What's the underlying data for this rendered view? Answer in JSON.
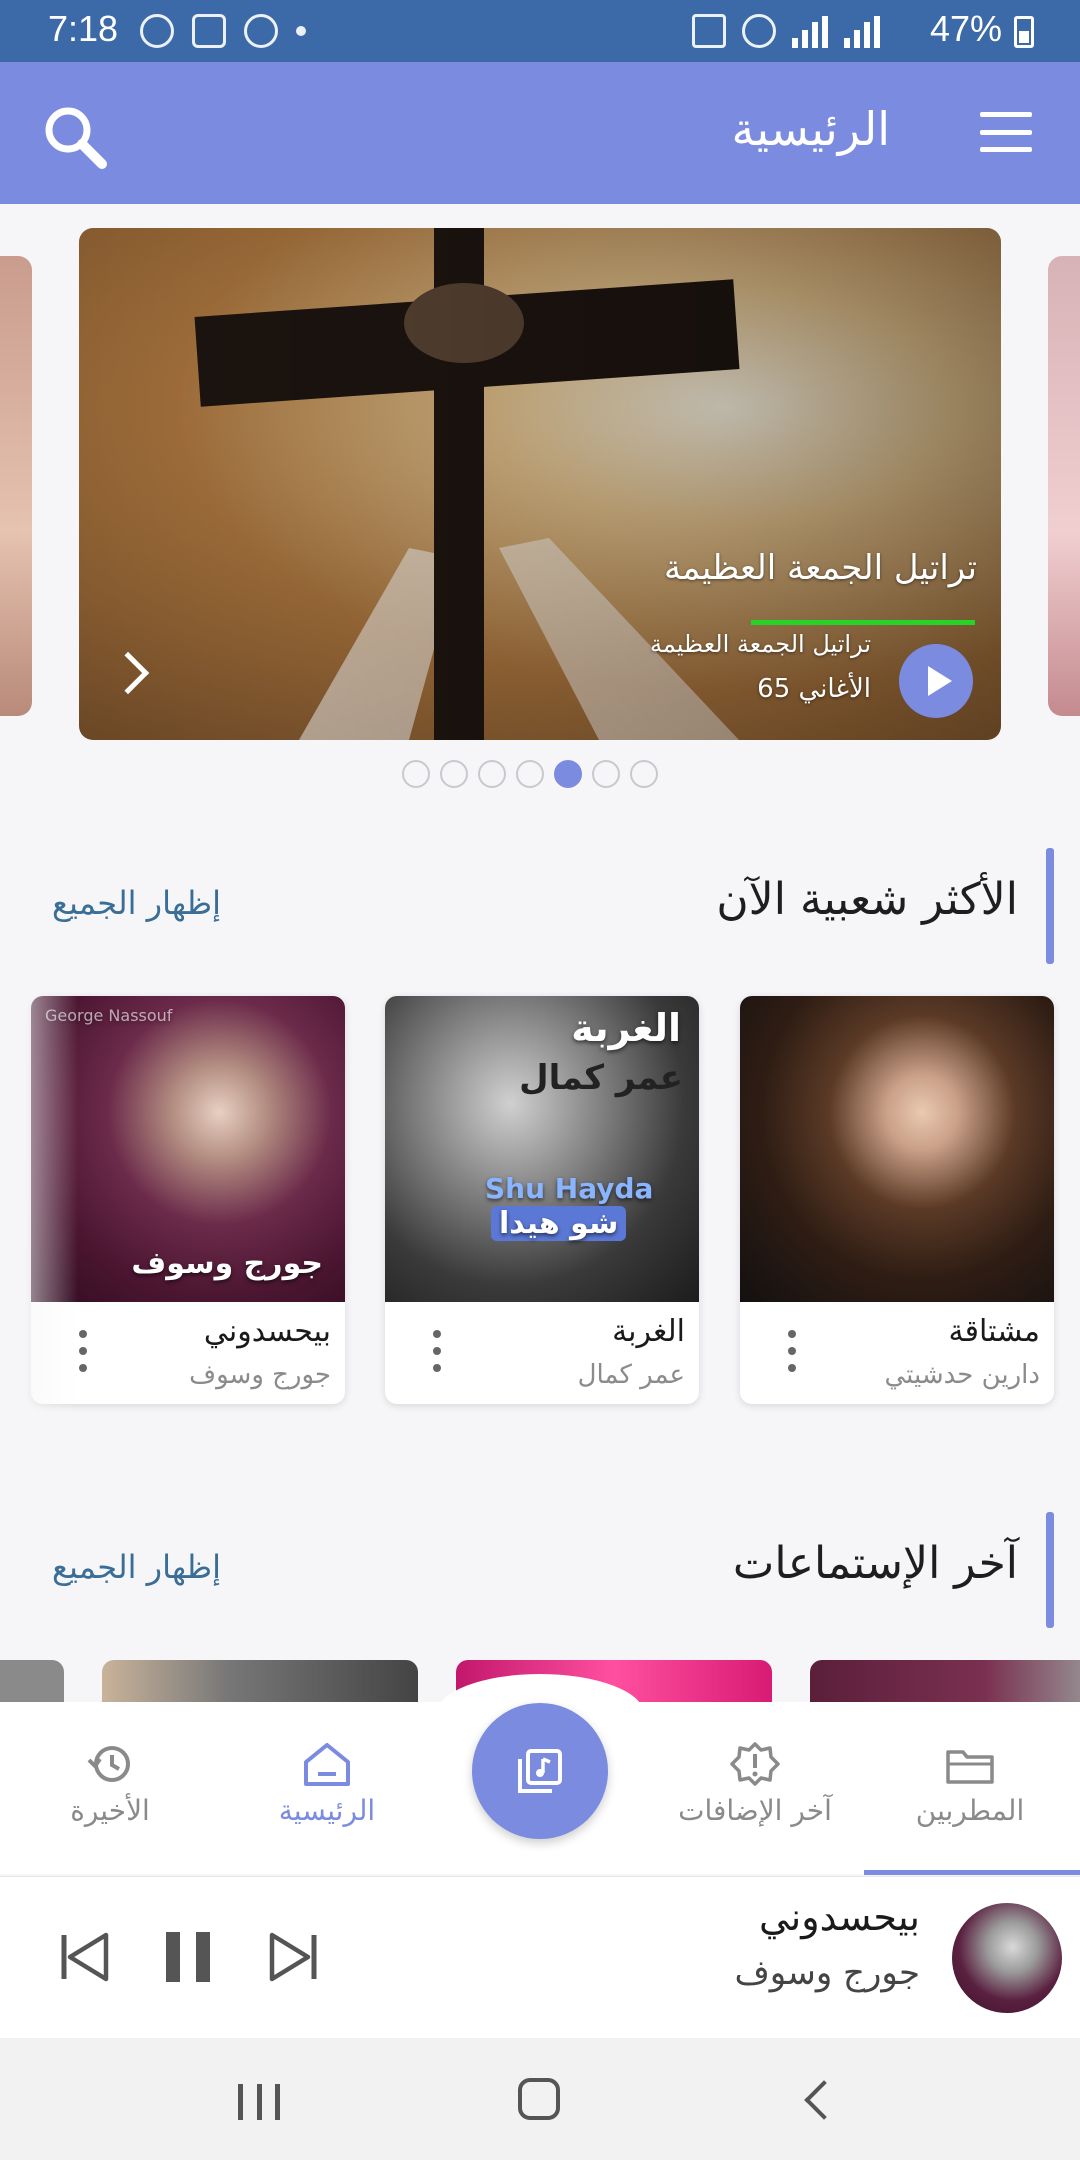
{
  "status_bar": {
    "time": "7:18",
    "battery": "47%"
  },
  "header": {
    "title": "الرئيسية"
  },
  "carousel": {
    "slide_title": "تراتيل الجمعة العظيمة",
    "slide_subtitle": "تراتيل الجمعة العظيمة",
    "slide_count": "65 الأغاني",
    "dots_total": 7,
    "active_dot": 5
  },
  "popular": {
    "title": "الأكثر شعبية الآن",
    "show_all": "إظهار الجميع",
    "cards": [
      {
        "title": "مشتاقة",
        "artist": "دارين حدشيتي"
      },
      {
        "title": "الغربة",
        "artist": "عمر كمال",
        "art_text_1": "الغربة",
        "art_text_2": "عمر كمال",
        "art_text_3": "Shu Hayda",
        "art_text_4": "شو هيدا"
      },
      {
        "title": "بيحسدوني",
        "artist": "جورج وسوف",
        "art_text_1": "جورج وسوف",
        "art_text_2": "George Nassouf"
      }
    ]
  },
  "recent": {
    "title": "آخر الإستماعات",
    "show_all": "إظهار الجميع"
  },
  "nav": {
    "recent_label": "الأخيرة",
    "home_label": "الرئيسية",
    "latest_label": "آخر الإضافات",
    "artists_label": "المطربين"
  },
  "player": {
    "title": "بيحسدوني",
    "artist": "جورج وسوف",
    "progress": 0.2
  },
  "colors": {
    "accent": "#7b8be0",
    "status_bar": "#3c6aa8",
    "link": "#3a6e96"
  }
}
